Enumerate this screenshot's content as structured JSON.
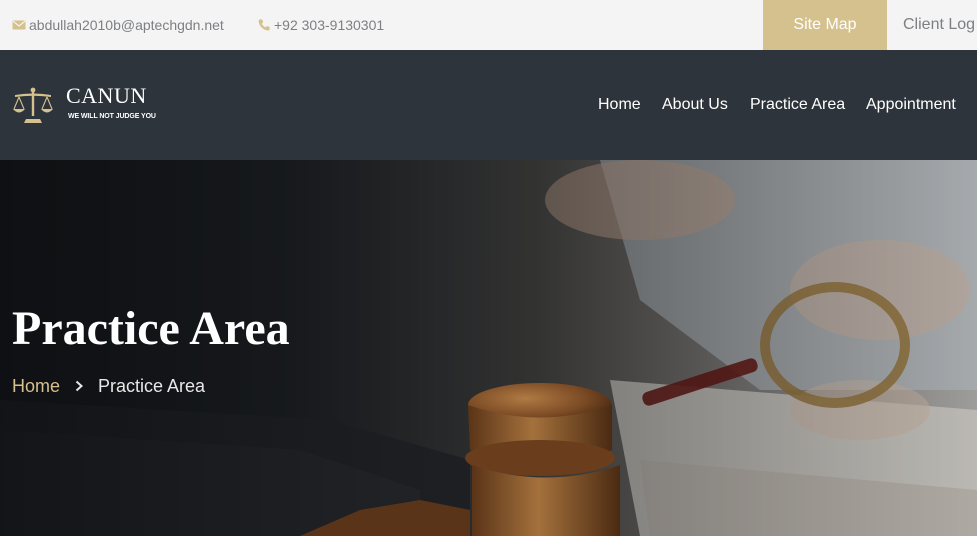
{
  "topbar": {
    "email": "abdullah2010b@aptechgdn.net",
    "phone": "+92 303-9130301",
    "site_map_label": "Site Map",
    "client_login_label": "Client Log",
    "email_icon": "envelope-icon",
    "phone_icon": "phone-icon"
  },
  "brand": {
    "name": "CANUN",
    "tagline": "WE WILL NOT JUDGE YOU",
    "logo_icon": "scales-of-justice-icon"
  },
  "nav": {
    "items": [
      {
        "label": "Home"
      },
      {
        "label": "About Us"
      },
      {
        "label": "Practice Area"
      },
      {
        "label": "Appointment"
      }
    ]
  },
  "hero": {
    "title": "Practice Area",
    "breadcrumb": {
      "home": "Home",
      "separator_icon": "chevron-right-icon",
      "current": "Practice Area"
    }
  },
  "colors": {
    "accent": "#d5c18d",
    "header_bg": "#2e343b",
    "topbar_bg": "#f4f4f4",
    "topbar_text": "#7d7f82"
  }
}
